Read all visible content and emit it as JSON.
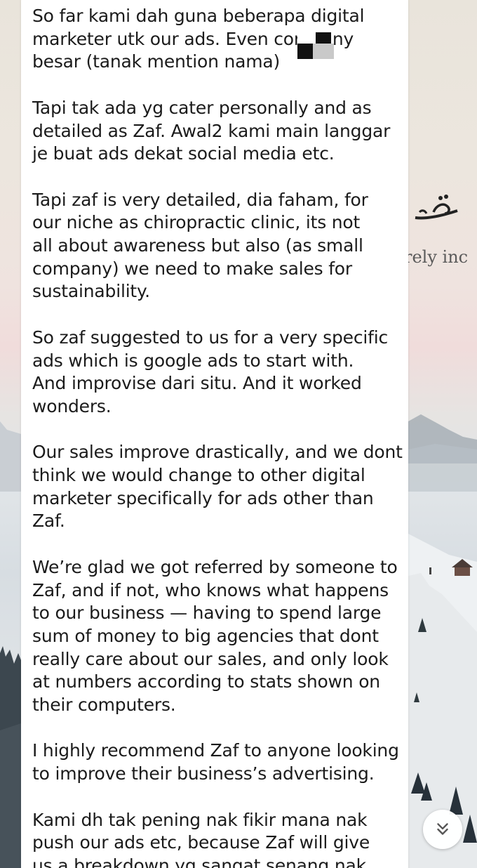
{
  "chat": {
    "message": {
      "paragraphs": [
        "So far kami dah guna beberapa digital\nmarketer utk our ads. Even company\nbesar (tanak mention nama)",
        "Tapi tak ada yg cater personally and as\ndetailed as Zaf. Awal2 kami main langgar\nje buat ads dekat social media etc.",
        "Tapi zaf is very detailed, dia faham, for\nour niche as chiropractic clinic, its not\nall about awareness but also (as small\ncompany) we need to make sales for\nsustainability.",
        "So zaf suggested to us for a very specific\nads which is google ads to start with.\nAnd improvise dari situ. And it worked\nwonders.",
        "Our sales improve drastically, and we dont\nthink we would change to other digital\nmarketer specifically for ads other than\nZaf.",
        "We’re glad we got referred by someone to\nZaf, and if not, who knows what happens\nto our business — having to spend large\nsum of money to big agencies that dont\nreally care about our sales, and only look\nat numbers according to stats shown on\ntheir computers.",
        "I highly recommend Zaf to anyone looking\nto improve their business’s advertising.",
        "Kami dh tak pening nak fikir mana nak\npush our ads etc, because Zaf will give\nus a breakdown yg sangat senang nak"
      ]
    },
    "background": {
      "text_fragment": "rely inc"
    },
    "scroll_down": {
      "icon": "double-chevron-down-icon"
    }
  },
  "colors": {
    "bubble": "#ffffff",
    "text": "#1b1b1b",
    "icon": "#555555"
  }
}
